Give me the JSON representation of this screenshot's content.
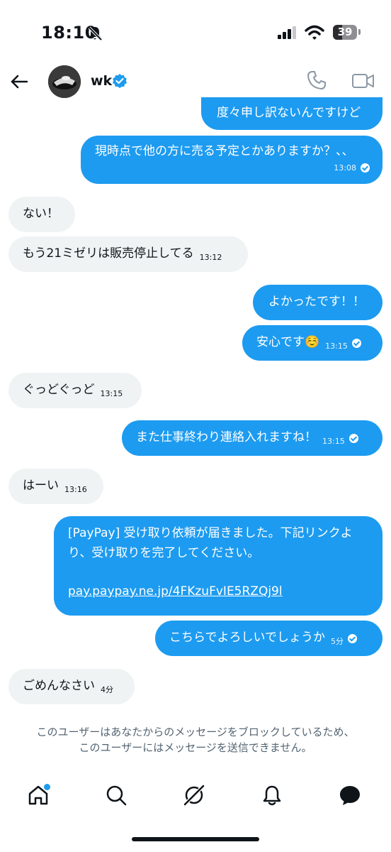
{
  "status_bar": {
    "time": "18:10",
    "battery": "39",
    "battery_level": 0.39
  },
  "header": {
    "username": "wk"
  },
  "messages": [
    {
      "text": "度々申し訳ないんですけど",
      "time": ""
    },
    {
      "text": "現時点で他の方に売る予定とかありますか？、、",
      "time": "13:08"
    },
    {
      "text": "ない！",
      "time": ""
    },
    {
      "text": "もう21ミゼリは販売停止してる",
      "time": "13:12"
    },
    {
      "text": "よかったです！！",
      "time": ""
    },
    {
      "text": "安心です☺️",
      "time": "13:15"
    },
    {
      "text": "ぐっどぐっど",
      "time": "13:15"
    },
    {
      "text": "また仕事終わり連絡入れますね！",
      "time": "13:15"
    },
    {
      "text": "はーい",
      "time": "13:16"
    },
    {
      "line1": "[PayPay] 受け取り依頼が届きました。下記リンクよ",
      "line2": "り、受け取りを完了してください。",
      "link": "pay.paypay.ne.jp/4FKzuFvIE5RZQj9l"
    },
    {
      "text": "こちらでよろしいでしょうか",
      "time": "5分"
    },
    {
      "text": "ごめんなさい",
      "time": "4分"
    }
  ],
  "footer": {
    "blocked_line1": "このユーザーはあなたからのメッセージをブロックしているため、",
    "blocked_line2": "このユーザーにはメッセージを送信できません。"
  },
  "icons": {
    "bell_off": "bell-slash-icon",
    "signal": "signal-icon",
    "wifi": "wifi-icon",
    "back": "arrow-left-icon",
    "verified": "verified-badge-icon",
    "phone": "phone-icon",
    "video": "video-camera-icon",
    "home": "home-icon",
    "search": "search-icon",
    "grok": "grok-icon",
    "notifications": "bell-icon",
    "messages": "chat-bubble-icon"
  },
  "colors": {
    "accent": "#1d9bf0",
    "incoming_bubble": "#eff3f4",
    "text": "#0f1419",
    "muted": "#536471"
  }
}
